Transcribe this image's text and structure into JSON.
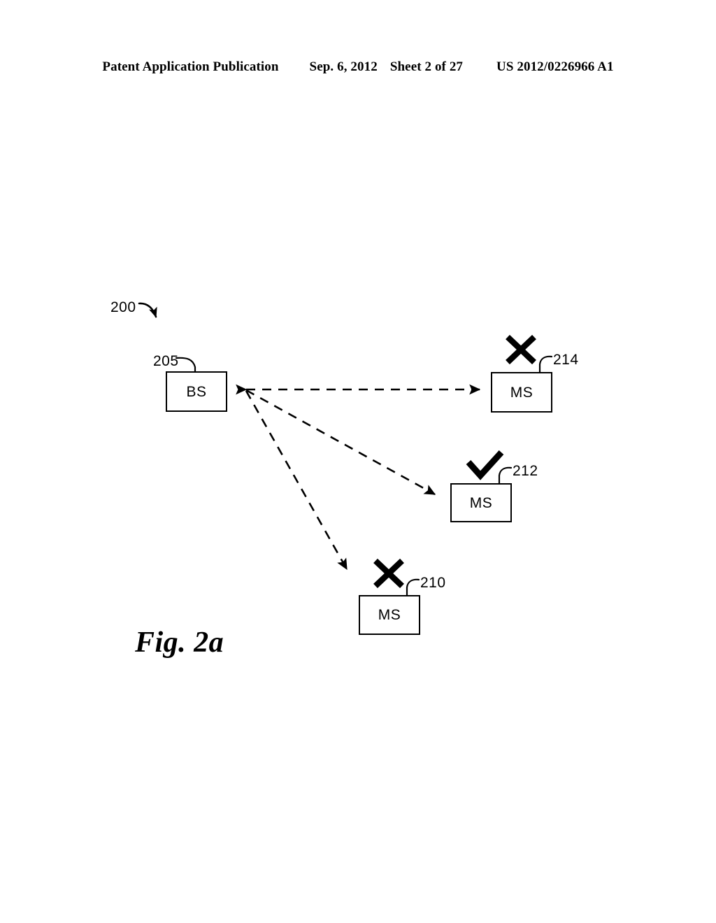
{
  "header": {
    "publication": "Patent Application Publication",
    "date": "Sep. 6, 2012",
    "sheet": "Sheet 2 of 27",
    "patent_number": "US 2012/0226966 A1"
  },
  "figure": {
    "caption": "Fig. 2a",
    "system_ref": "200",
    "nodes": [
      {
        "id": "bs",
        "label": "BS",
        "ref": "205",
        "status_icon": "none"
      },
      {
        "id": "ms_214",
        "label": "MS",
        "ref": "214",
        "status_icon": "cross-icon"
      },
      {
        "id": "ms_212",
        "label": "MS",
        "ref": "212",
        "status_icon": "check-icon"
      },
      {
        "id": "ms_210",
        "label": "MS",
        "ref": "210",
        "status_icon": "cross-icon"
      }
    ],
    "links": [
      {
        "from": "bs",
        "to": "ms_214",
        "style": "dashed",
        "arrows": "both"
      },
      {
        "from": "bs",
        "to": "ms_212",
        "style": "dashed",
        "arrows": "both"
      },
      {
        "from": "bs",
        "to": "ms_210",
        "style": "dashed",
        "arrows": "both"
      }
    ],
    "colors": {
      "ink": "#000000",
      "paper": "#ffffff"
    }
  }
}
